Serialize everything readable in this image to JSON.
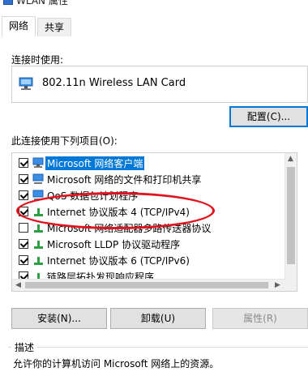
{
  "window": {
    "title": "WLAN 属性"
  },
  "tabs": [
    {
      "label": "网络",
      "active": true
    },
    {
      "label": "共享",
      "active": false
    }
  ],
  "connect_using": {
    "label": "连接时使用:",
    "adapter_name": "802.11n Wireless LAN Card",
    "configure_button": "配置(C)..."
  },
  "items_label": "此连接使用下列项目(O):",
  "items": [
    {
      "label": "Microsoft 网络客户端",
      "checked": true,
      "icon": "network-client-icon",
      "selected": true
    },
    {
      "label": "Microsoft 网络的文件和打印机共享",
      "checked": true,
      "icon": "file-print-sharing-icon",
      "selected": false
    },
    {
      "label": "QoS 数据包计划程序",
      "checked": true,
      "icon": "qos-scheduler-icon",
      "selected": false
    },
    {
      "label": "Internet 协议版本 4 (TCP/IPv4)",
      "checked": true,
      "icon": "protocol-icon",
      "selected": false
    },
    {
      "label": "Microsoft 网络适配器多路传送器协议",
      "checked": false,
      "icon": "protocol-icon",
      "selected": false
    },
    {
      "label": "Microsoft LLDP 协议驱动程序",
      "checked": true,
      "icon": "protocol-icon",
      "selected": false
    },
    {
      "label": "Internet 协议版本 6 (TCP/IPv6)",
      "checked": true,
      "icon": "protocol-icon",
      "selected": false
    },
    {
      "label": "链路层拓扑发现响应程序",
      "checked": true,
      "icon": "protocol-icon",
      "selected": false
    }
  ],
  "buttons": {
    "install": "安装(N)...",
    "uninstall": "卸载(U)",
    "properties": "属性(R)"
  },
  "description": {
    "title": "描述",
    "text": "允许你的计算机访问 Microsoft 网络上的资源。"
  },
  "colors": {
    "accent": "#0078d7",
    "annotation_oval": "#e0141e",
    "protocol_icon": "#2ea043"
  }
}
